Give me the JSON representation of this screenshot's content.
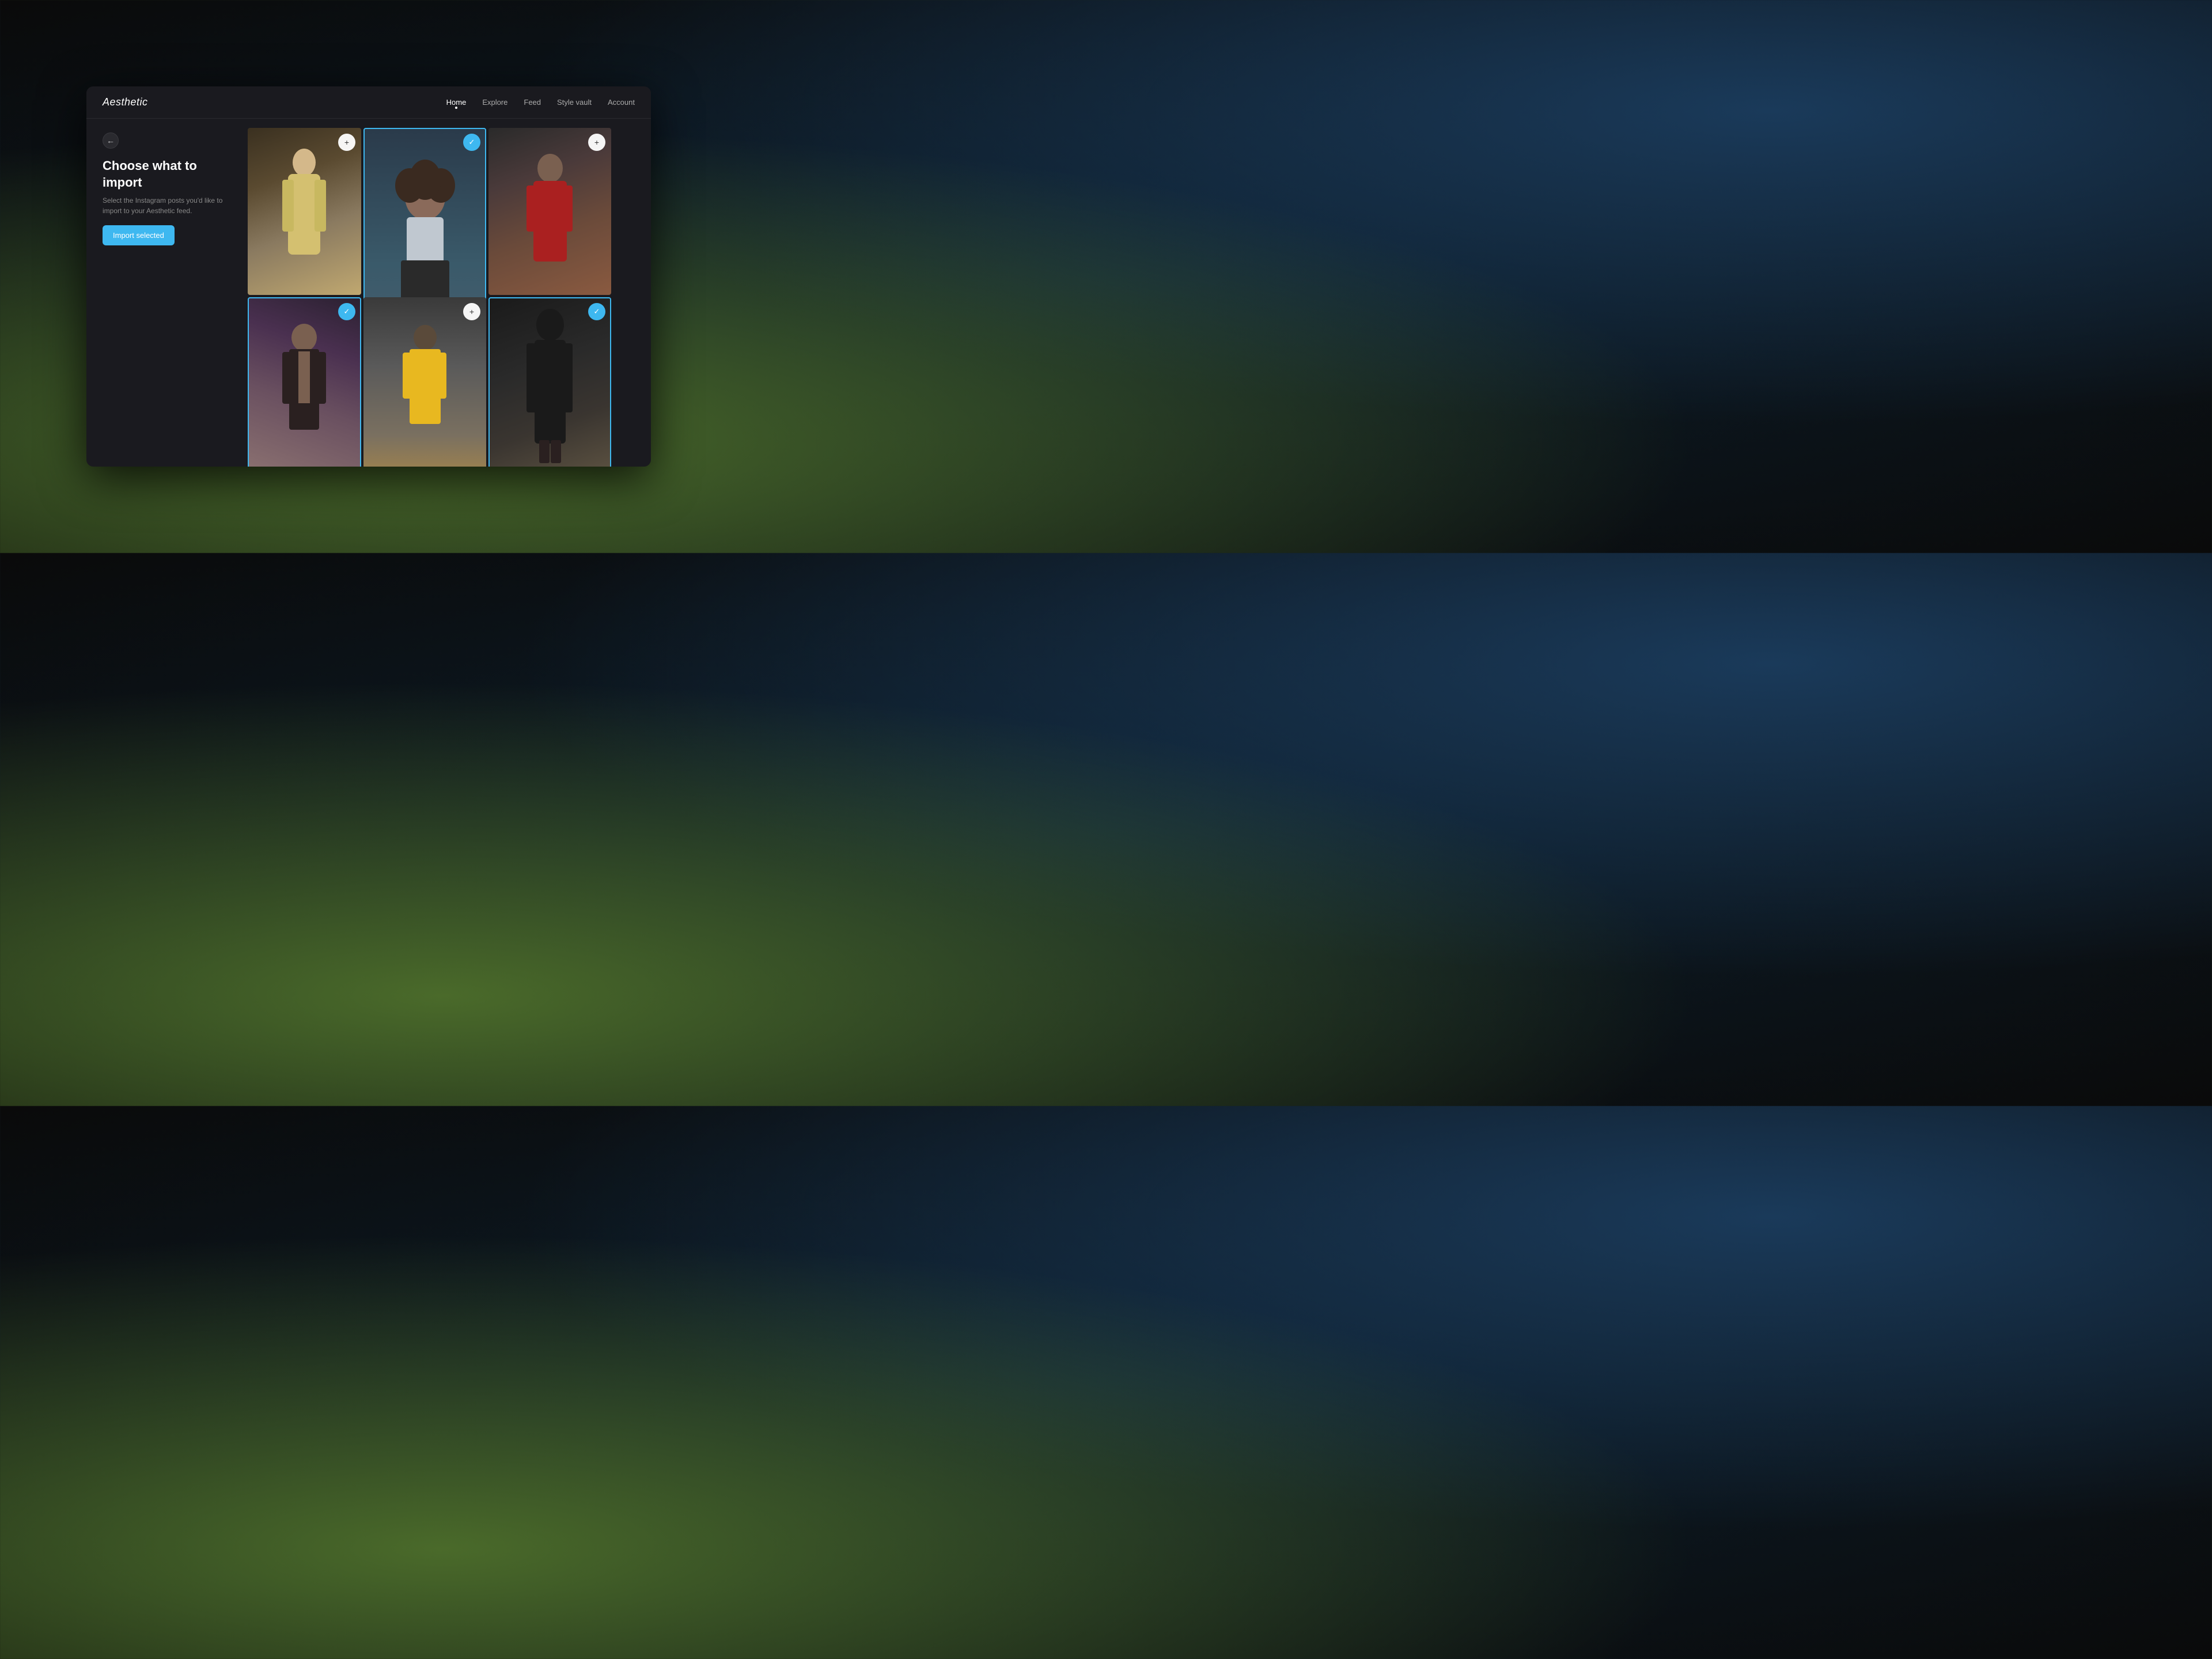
{
  "app": {
    "logo": "Aesthetic",
    "nav": {
      "links": [
        {
          "label": "Home",
          "active": true
        },
        {
          "label": "Explore",
          "active": false
        },
        {
          "label": "Feed",
          "active": false
        },
        {
          "label": "Style vault",
          "active": false
        },
        {
          "label": "Account",
          "active": false
        }
      ]
    }
  },
  "page": {
    "back_label": "←",
    "title": "Choose what to import",
    "subtitle": "Select the Instagram posts you'd like to import to your Aesthetic feed.",
    "import_button": "Import selected"
  },
  "photos": [
    {
      "id": 1,
      "selected": false,
      "action": "add"
    },
    {
      "id": 2,
      "selected": true,
      "action": "check"
    },
    {
      "id": 3,
      "selected": false,
      "action": "add"
    },
    {
      "id": 4,
      "selected": true,
      "action": "check"
    },
    {
      "id": 5,
      "selected": false,
      "action": "add"
    },
    {
      "id": 6,
      "selected": true,
      "action": "check"
    }
  ],
  "icons": {
    "back": "←",
    "plus": "+",
    "check": "✓"
  }
}
